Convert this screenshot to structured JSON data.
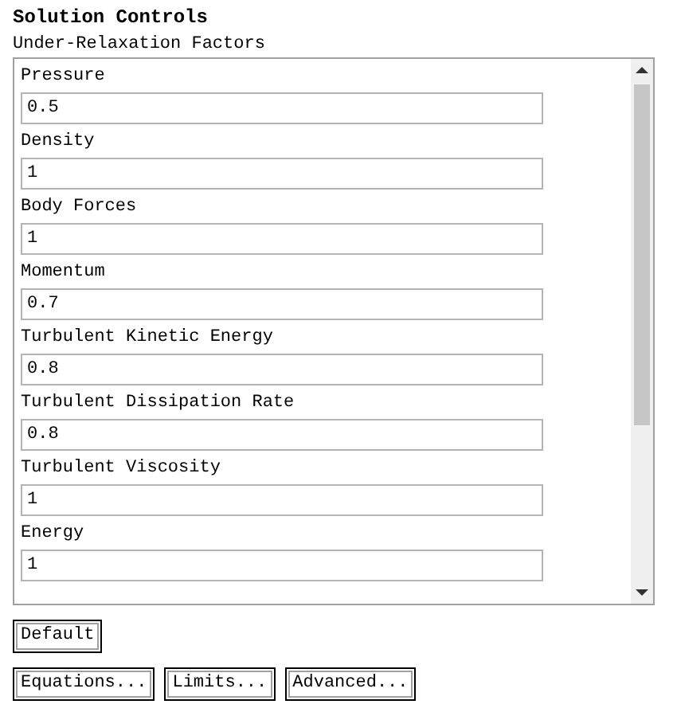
{
  "title": "Solution Controls",
  "section": "Under-Relaxation Factors",
  "fields": [
    {
      "label": "Pressure",
      "value": "0.5"
    },
    {
      "label": "Density",
      "value": "1"
    },
    {
      "label": "Body Forces",
      "value": "1"
    },
    {
      "label": "Momentum",
      "value": "0.7"
    },
    {
      "label": "Turbulent Kinetic Energy",
      "value": "0.8"
    },
    {
      "label": "Turbulent Dissipation Rate",
      "value": "0.8"
    },
    {
      "label": "Turbulent Viscosity",
      "value": "1"
    },
    {
      "label": "Energy",
      "value": "1"
    }
  ],
  "default_button": "Default",
  "buttons": [
    "Equations...",
    "Limits...",
    "Advanced..."
  ]
}
